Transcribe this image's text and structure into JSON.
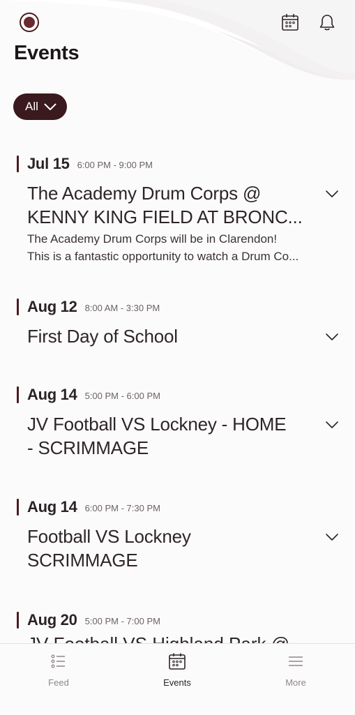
{
  "header": {
    "title": "Events",
    "logo": "school-logo",
    "icons": [
      "calendar-icon",
      "bell-icon"
    ]
  },
  "filter": {
    "label": "All"
  },
  "events": [
    {
      "date": "Jul 15",
      "time": "6:00 PM - 9:00 PM",
      "title_line1": "The Academy Drum Corps @",
      "title_line2": "KENNY KING FIELD AT BRONC...",
      "desc_line1": "The Academy Drum Corps will be in Clarendon!",
      "desc_line2": "This is a fantastic opportunity to watch a Drum Co..."
    },
    {
      "date": "Aug 12",
      "time": "8:00 AM - 3:30 PM",
      "title_line1": "First Day of School"
    },
    {
      "date": "Aug 14",
      "time": "5:00 PM - 6:00 PM",
      "title_line1": "JV Football VS Lockney - HOME",
      "title_line2": "- SCRIMMAGE"
    },
    {
      "date": "Aug 14",
      "time": "6:00 PM - 7:30 PM",
      "title_line1": "Football VS Lockney",
      "title_line2": "SCRIMMAGE"
    },
    {
      "date": "Aug 20",
      "time": "5:00 PM - 7:00 PM",
      "title_line1": "JV Football VS Highland Park @"
    }
  ],
  "nav": {
    "items": [
      {
        "label": "Feed",
        "icon": "list-icon"
      },
      {
        "label": "Events",
        "icon": "calendar-icon"
      },
      {
        "label": "More",
        "icon": "menu-icon"
      }
    ],
    "active": "Events"
  },
  "colors": {
    "accent": "#3a1a1d",
    "background": "#fcfbfb"
  }
}
